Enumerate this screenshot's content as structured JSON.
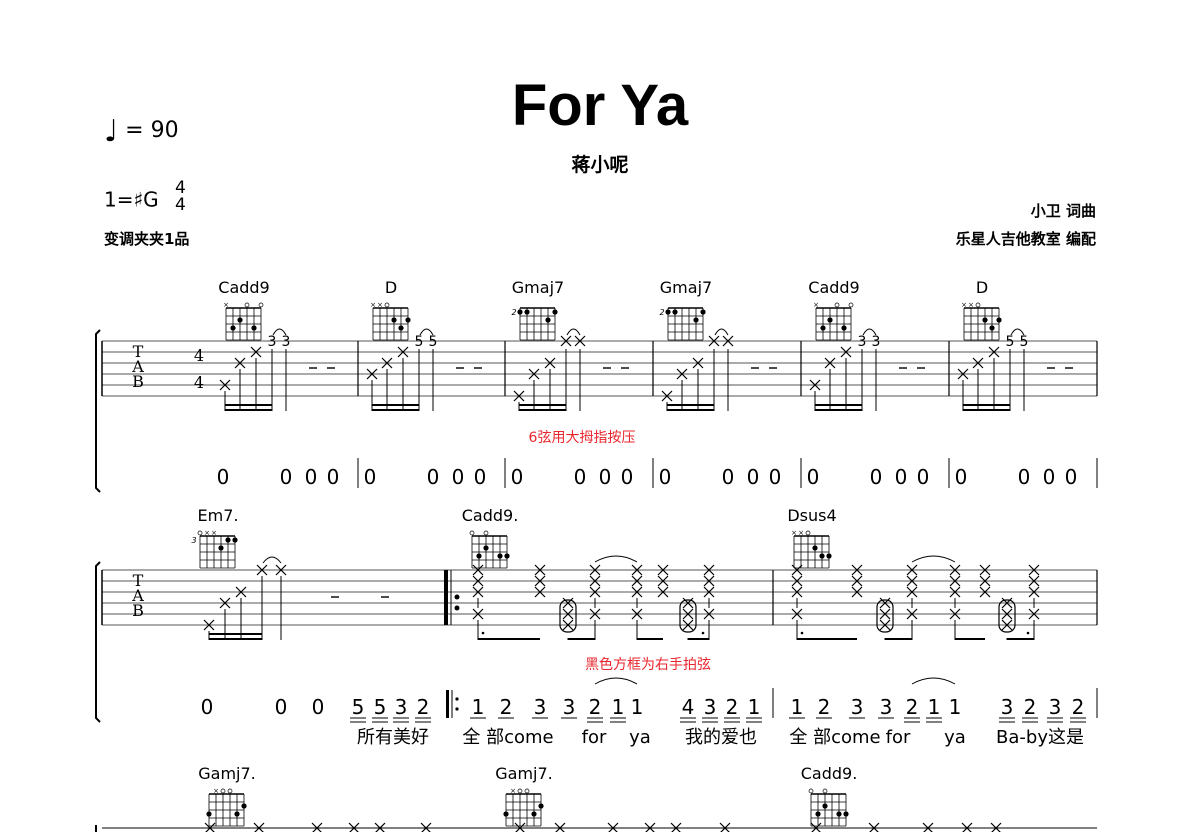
{
  "header": {
    "title": "For Ya",
    "singer": "蒋小呢",
    "tempo": "= 90",
    "key": "1=♯G",
    "time_signature": [
      "4",
      "4"
    ],
    "capo": "变调夹夹1品",
    "lyricist_composer": "小卫  词曲",
    "arranger": "乐星人吉他教室  编配"
  },
  "annotations": {
    "thumb_note": "6弦用大拇指按压",
    "slap_note": "黑色方框为右手拍弦",
    "annotation_color": "#e8262d"
  },
  "tab_clef": [
    "T",
    "A",
    "B"
  ],
  "system1": {
    "measures": [
      {
        "chord": "Cadd9",
        "frets": [
          "3",
          "3"
        ],
        "numbered": [
          "0",
          "0",
          "0",
          "0"
        ]
      },
      {
        "chord": "D",
        "frets": [
          "5",
          "5"
        ],
        "numbered": [
          "0",
          "0",
          "0",
          "0"
        ]
      },
      {
        "chord": "Gmaj7",
        "frets": [
          "×",
          "×"
        ],
        "numbered": [
          "0",
          "0",
          "0",
          "0"
        ]
      },
      {
        "chord": "Gmaj7",
        "frets": [
          "×",
          "×"
        ],
        "numbered": [
          "0",
          "0",
          "0",
          "0"
        ]
      },
      {
        "chord": "Cadd9",
        "frets": [
          "3",
          "3"
        ],
        "numbered": [
          "0",
          "0",
          "0",
          "0"
        ]
      },
      {
        "chord": "D",
        "frets": [
          "5",
          "5"
        ],
        "numbered": [
          "0",
          "0",
          "0",
          "0"
        ]
      }
    ]
  },
  "system2": {
    "chords": [
      "Em7.",
      "Cadd9.",
      "Dsus4"
    ],
    "numbered": [
      "0",
      "0",
      "0",
      "5",
      "5",
      "3",
      "2",
      "1",
      "2",
      "3",
      "3",
      "2",
      "1",
      "1",
      "4",
      "3",
      "2",
      "1",
      "1",
      "2",
      "3",
      "3",
      "2",
      "1",
      "1",
      "3",
      "2",
      "3",
      "2"
    ],
    "lyrics": [
      "所有美好",
      "全 部come",
      "for",
      "ya",
      "我的爱也",
      "全 部come",
      "for",
      "ya",
      "Ba-by这是"
    ]
  },
  "system3": {
    "chords": [
      "Gamj7.",
      "Gamj7.",
      "Cadd9."
    ]
  }
}
